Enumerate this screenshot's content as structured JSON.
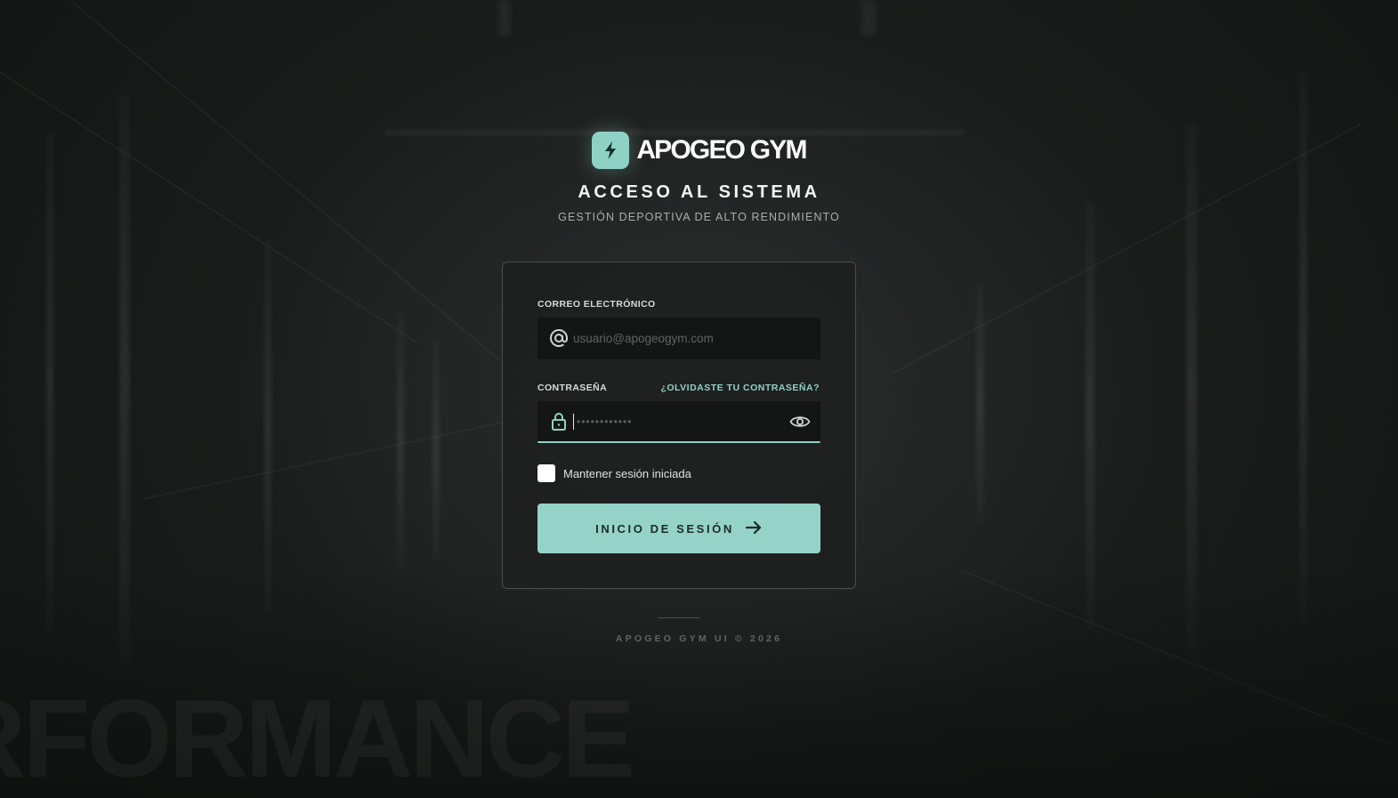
{
  "brand": {
    "name": "APOGEO GYM",
    "logo_icon": "bolt-icon",
    "accent_color": "#8fd2c5"
  },
  "header": {
    "title": "ACCESO AL SISTEMA",
    "subtitle": "GESTIÓN DEPORTIVA DE ALTO RENDIMIENTO"
  },
  "form": {
    "email": {
      "label": "CORREO ELECTRÓNICO",
      "placeholder": "usuario@apogeogym.com",
      "value": "",
      "icon": "at-sign-icon"
    },
    "password": {
      "label": "CONTRASEÑA",
      "placeholder": "••••••••••••",
      "value": "",
      "icon": "lock-icon",
      "toggle_icon": "eye-icon"
    },
    "forgot_link": "¿OLVIDASTE TU CONTRASEÑA?",
    "remember_label": "Mantener sesión iniciada",
    "remember_checked": false,
    "submit_label": "INICIO DE SESIÓN",
    "submit_icon": "arrow-right-icon"
  },
  "footer": {
    "text": "APOGEO GYM UI © 2026"
  },
  "background": {
    "watermark_text": "RFORMANCE"
  }
}
